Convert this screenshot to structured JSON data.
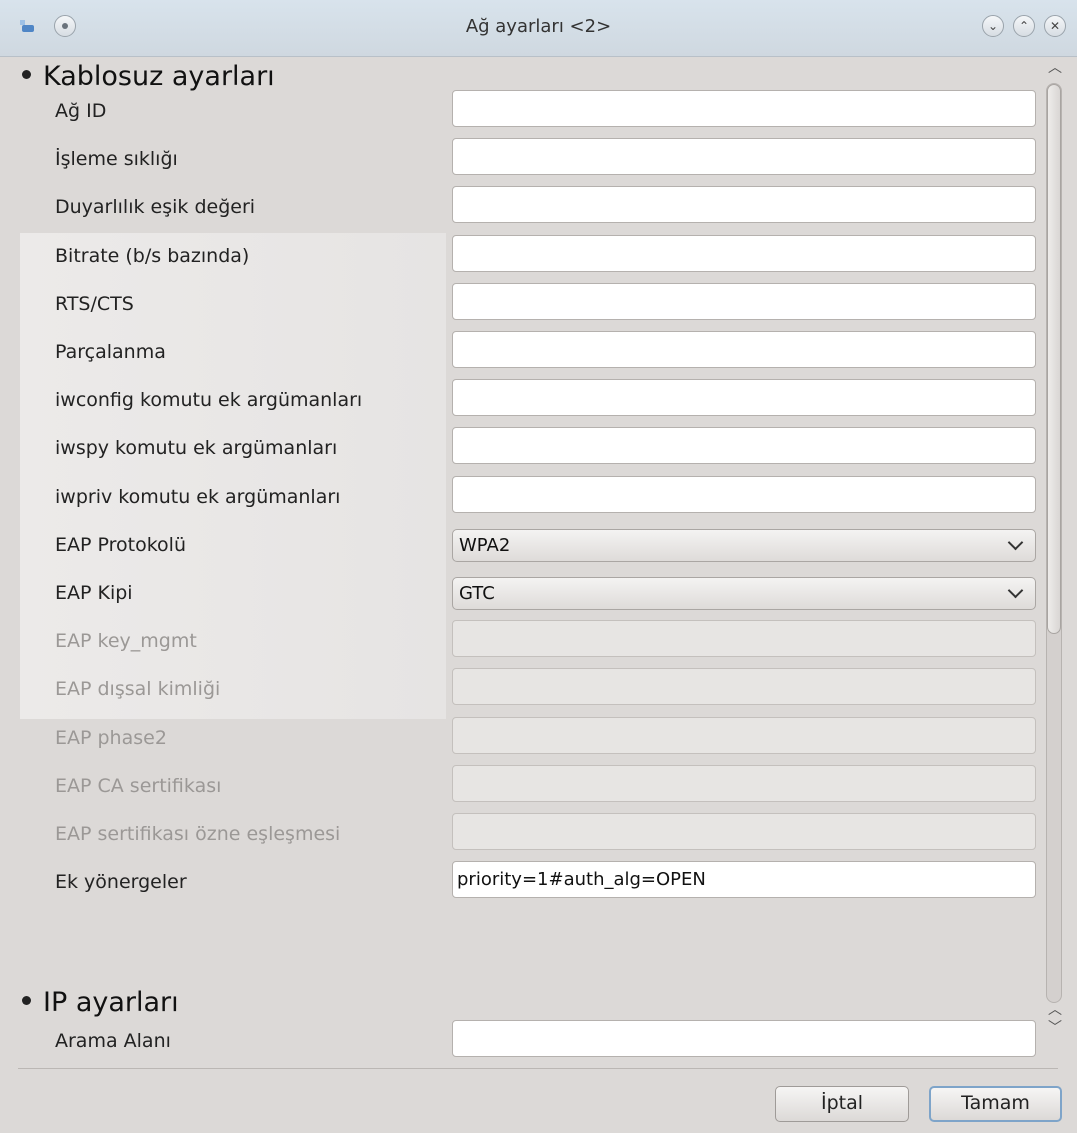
{
  "window": {
    "title": "Ağ ayarları <2>"
  },
  "titlebar": {
    "buttons": [
      "minimize-icon",
      "maximize-icon",
      "close-icon"
    ]
  },
  "wireless": {
    "section_title": "Kablosuz ayarları",
    "rows": [
      {
        "label": "Ağ ID",
        "type": "text",
        "value": "",
        "enabled": true
      },
      {
        "label": "İşleme sıklığı",
        "type": "text",
        "value": "",
        "enabled": true
      },
      {
        "label": "Duyarlılık eşik değeri",
        "type": "text",
        "value": "",
        "enabled": true
      },
      {
        "label": "Bitrate (b/s bazında)",
        "type": "text",
        "value": "",
        "enabled": true
      },
      {
        "label": "RTS/CTS",
        "type": "text",
        "value": "",
        "enabled": true
      },
      {
        "label": "Parçalanma",
        "type": "text",
        "value": "",
        "enabled": true
      },
      {
        "label": "iwconfig komutu ek argümanları",
        "type": "text",
        "value": "",
        "enabled": true
      },
      {
        "label": "iwspy komutu ek argümanları",
        "type": "text",
        "value": "",
        "enabled": true
      },
      {
        "label": "iwpriv komutu ek argümanları",
        "type": "text",
        "value": "",
        "enabled": true
      },
      {
        "label": "EAP Protokolü",
        "type": "select",
        "value": "WPA2",
        "enabled": true
      },
      {
        "label": "EAP Kipi",
        "type": "select",
        "value": "GTC",
        "enabled": true
      },
      {
        "label": "EAP key_mgmt",
        "type": "text",
        "value": "",
        "enabled": false
      },
      {
        "label": "EAP dışsal kimliği",
        "type": "text",
        "value": "",
        "enabled": false
      },
      {
        "label": "EAP phase2",
        "type": "text",
        "value": "",
        "enabled": false
      },
      {
        "label": "EAP CA sertifikası",
        "type": "text",
        "value": "",
        "enabled": false
      },
      {
        "label": "EAP sertifikası özne eşleşmesi",
        "type": "text",
        "value": "",
        "enabled": false
      },
      {
        "label": "Ek yönergeler",
        "type": "text",
        "value": "priority=1#auth_alg=OPEN",
        "enabled": true
      }
    ]
  },
  "ip": {
    "section_title": "IP ayarları",
    "rows": [
      {
        "label": "Arama Alanı",
        "type": "text",
        "value": "",
        "enabled": true
      }
    ]
  },
  "buttons": {
    "cancel": "İptal",
    "ok": "Tamam"
  },
  "colors": {
    "titlebar": "#d3dde6",
    "focus_border": "#7ea4c9",
    "disabled_text": "#9b9896"
  }
}
